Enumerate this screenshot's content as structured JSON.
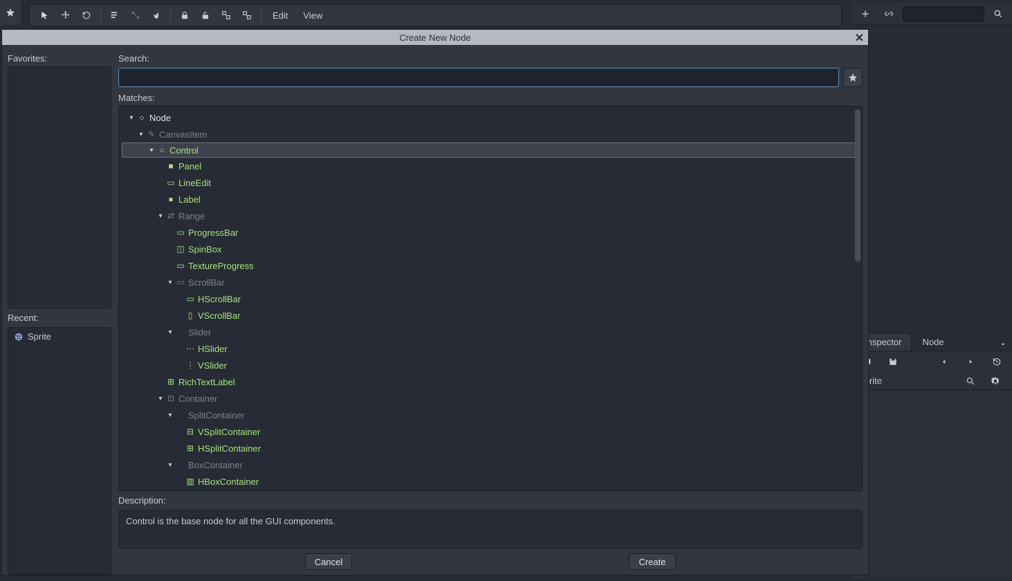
{
  "toolbar": {
    "menus": {
      "edit": "Edit",
      "view": "View"
    }
  },
  "dialog": {
    "title": "Create New Node",
    "favorites_label": "Favorites:",
    "recent_label": "Recent:",
    "search_label": "Search:",
    "matches_label": "Matches:",
    "description_label": "Description:",
    "description_text": "Control is the base node for all the GUI components.",
    "search_value": "",
    "recent_items": [
      {
        "label": "Sprite",
        "icon": "sprite-icon"
      }
    ],
    "buttons": {
      "cancel": "Cancel",
      "create": "Create"
    },
    "tree": [
      {
        "depth": 0,
        "label": "Node",
        "expander": true,
        "color": "c-white",
        "icon": "○"
      },
      {
        "depth": 1,
        "label": "CanvasItem",
        "expander": true,
        "color": "dim",
        "icon": "✎"
      },
      {
        "depth": 2,
        "label": "Control",
        "expander": true,
        "color": "c-green",
        "icon": "○",
        "selected": true
      },
      {
        "depth": 3,
        "label": "Panel",
        "expander": false,
        "color": "c-green",
        "icon": "■"
      },
      {
        "depth": 3,
        "label": "LineEdit",
        "expander": false,
        "color": "c-green",
        "icon": "▭"
      },
      {
        "depth": 3,
        "label": "Label",
        "expander": false,
        "color": "c-green",
        "icon": "⏹"
      },
      {
        "depth": 3,
        "label": "Range",
        "expander": true,
        "color": "dim",
        "icon": "⇄"
      },
      {
        "depth": 4,
        "label": "ProgressBar",
        "expander": false,
        "color": "c-green",
        "icon": "▭"
      },
      {
        "depth": 4,
        "label": "SpinBox",
        "expander": false,
        "color": "c-green",
        "icon": "◫"
      },
      {
        "depth": 4,
        "label": "TextureProgress",
        "expander": false,
        "color": "c-green",
        "icon": "▭"
      },
      {
        "depth": 4,
        "label": "ScrollBar",
        "expander": true,
        "color": "dim",
        "icon": "▭"
      },
      {
        "depth": 5,
        "label": "HScrollBar",
        "expander": false,
        "color": "c-green",
        "icon": "▭"
      },
      {
        "depth": 5,
        "label": "VScrollBar",
        "expander": false,
        "color": "c-green",
        "icon": "▯"
      },
      {
        "depth": 4,
        "label": "Slider",
        "expander": true,
        "color": "dim",
        "icon": ""
      },
      {
        "depth": 5,
        "label": "HSlider",
        "expander": false,
        "color": "c-green",
        "icon": "⋯"
      },
      {
        "depth": 5,
        "label": "VSlider",
        "expander": false,
        "color": "c-green",
        "icon": "⋮"
      },
      {
        "depth": 3,
        "label": "RichTextLabel",
        "expander": false,
        "color": "c-green",
        "icon": "⊞"
      },
      {
        "depth": 3,
        "label": "Container",
        "expander": true,
        "color": "dim",
        "icon": "⊡"
      },
      {
        "depth": 4,
        "label": "SplitContainer",
        "expander": true,
        "color": "dim",
        "icon": ""
      },
      {
        "depth": 5,
        "label": "VSplitContainer",
        "expander": false,
        "color": "c-green",
        "icon": "⊟"
      },
      {
        "depth": 5,
        "label": "HSplitContainer",
        "expander": false,
        "color": "c-green",
        "icon": "⊞"
      },
      {
        "depth": 4,
        "label": "BoxContainer",
        "expander": true,
        "color": "dim",
        "icon": ""
      },
      {
        "depth": 5,
        "label": "HBoxContainer",
        "expander": false,
        "color": "c-green",
        "icon": "▥"
      }
    ]
  },
  "inspector": {
    "tabs": {
      "inspector": "Inspector",
      "node": "Node"
    },
    "object_name": "Sprite"
  }
}
